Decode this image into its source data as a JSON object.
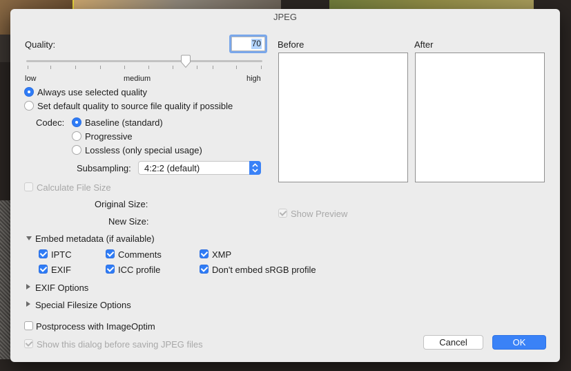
{
  "window": {
    "title": "JPEG"
  },
  "quality": {
    "label": "Quality:",
    "value": "70",
    "slider_fraction": 0.68,
    "scale_low": "low",
    "scale_medium": "medium",
    "scale_high": "high"
  },
  "quality_mode": {
    "always": {
      "label": "Always use selected quality",
      "selected": true
    },
    "source": {
      "label": "Set default quality to source file quality if possible",
      "selected": false
    }
  },
  "codec": {
    "label": "Codec:",
    "options": [
      {
        "label": "Baseline (standard)",
        "selected": true
      },
      {
        "label": "Progressive",
        "selected": false
      },
      {
        "label": "Lossless (only special usage)",
        "selected": false
      }
    ]
  },
  "subsampling": {
    "label": "Subsampling:",
    "value": "4:2:2 (default)"
  },
  "file_size": {
    "calculate_label": "Calculate File Size",
    "original_label": "Original Size:",
    "new_label": "New Size:"
  },
  "preview": {
    "before_label": "Before",
    "after_label": "After",
    "show_preview_label": "Show Preview",
    "show_preview_checked": true
  },
  "metadata": {
    "header": "Embed metadata (if available)",
    "items": [
      {
        "label": "IPTC",
        "checked": true
      },
      {
        "label": "Comments",
        "checked": true
      },
      {
        "label": "XMP",
        "checked": true
      },
      {
        "label": "EXIF",
        "checked": true
      },
      {
        "label": "ICC profile",
        "checked": true
      },
      {
        "label": "Don't embed sRGB profile",
        "checked": true
      }
    ]
  },
  "sections": {
    "exif_options": "EXIF Options",
    "special_filesize": "Special Filesize Options"
  },
  "postprocess": {
    "label": "Postprocess with ImageOptim",
    "checked": false
  },
  "show_dialog": {
    "label": "Show this dialog before saving JPEG files",
    "checked": true
  },
  "buttons": {
    "cancel": "Cancel",
    "ok": "OK"
  },
  "colors": {
    "accent": "#2f7cf6",
    "dialog_bg": "#ececec",
    "focus_ring": "#7aa7ea"
  }
}
